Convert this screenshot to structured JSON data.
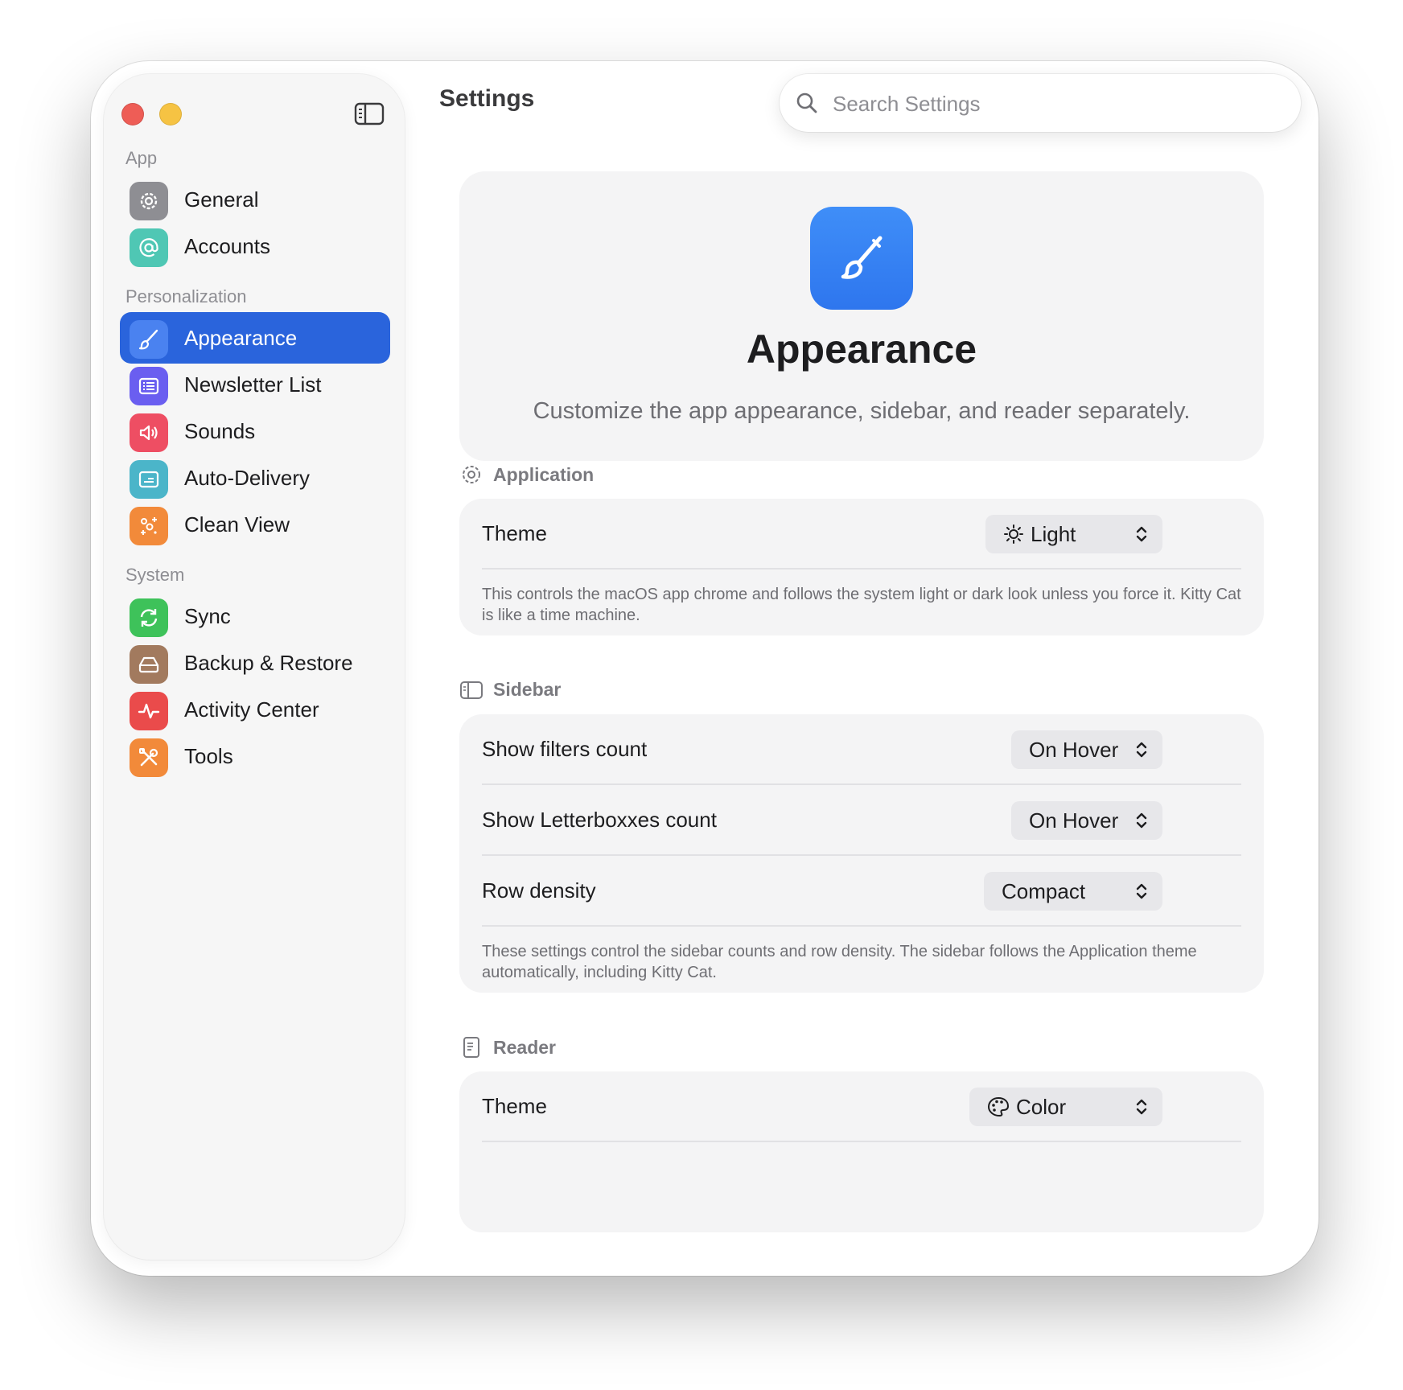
{
  "window": {
    "title": "Settings"
  },
  "search": {
    "placeholder": "Search Settings"
  },
  "sidebar": {
    "sections": [
      {
        "label": "App"
      },
      {
        "label": "Personalization"
      },
      {
        "label": "System"
      }
    ],
    "items": [
      {
        "label": "General",
        "icon": "gear-icon",
        "color": "#8e8e93"
      },
      {
        "label": "Accounts",
        "icon": "at-sign-icon",
        "color": "#4fc7b4"
      },
      {
        "label": "Appearance",
        "icon": "paintbrush-icon",
        "color": "#2a64dc",
        "selected": true
      },
      {
        "label": "Newsletter List",
        "icon": "list-icon",
        "color": "#6a5ef0"
      },
      {
        "label": "Sounds",
        "icon": "speaker-icon",
        "color": "#ee4e63"
      },
      {
        "label": "Auto-Delivery",
        "icon": "inbox-icon",
        "color": "#4bb5c9"
      },
      {
        "label": "Clean View",
        "icon": "sparkles-icon",
        "color": "#f28a3a"
      },
      {
        "label": "Sync",
        "icon": "sync-icon",
        "color": "#3ec25a"
      },
      {
        "label": "Backup & Restore",
        "icon": "drive-icon",
        "color": "#a27a5e"
      },
      {
        "label": "Activity Center",
        "icon": "waveform-icon",
        "color": "#ea4b4b"
      },
      {
        "label": "Tools",
        "icon": "tools-icon",
        "color": "#f28a3a"
      }
    ]
  },
  "hero": {
    "title": "Appearance",
    "subtitle": "Customize the app appearance, sidebar, and reader separately.",
    "icon": "paintbrush-icon",
    "color": "#3a86f5"
  },
  "application": {
    "heading": "Application",
    "theme_label": "Theme",
    "theme_value": "Light",
    "theme_icon": "sun-icon",
    "note": "This controls the macOS app chrome and follows the system light or dark look unless you force it. Kitty Cat is like a time machine."
  },
  "sidebar_group": {
    "heading": "Sidebar",
    "rows": [
      {
        "label": "Show filters count",
        "value": "On Hover"
      },
      {
        "label": "Show Letterboxxes count",
        "value": "On Hover"
      },
      {
        "label": "Row density",
        "value": "Compact"
      }
    ],
    "note": "These settings control the sidebar counts and row density. The sidebar follows the Application theme automatically, including Kitty Cat."
  },
  "reader": {
    "heading": "Reader",
    "theme_label": "Theme",
    "theme_value": "Color",
    "theme_icon": "palette-icon"
  }
}
